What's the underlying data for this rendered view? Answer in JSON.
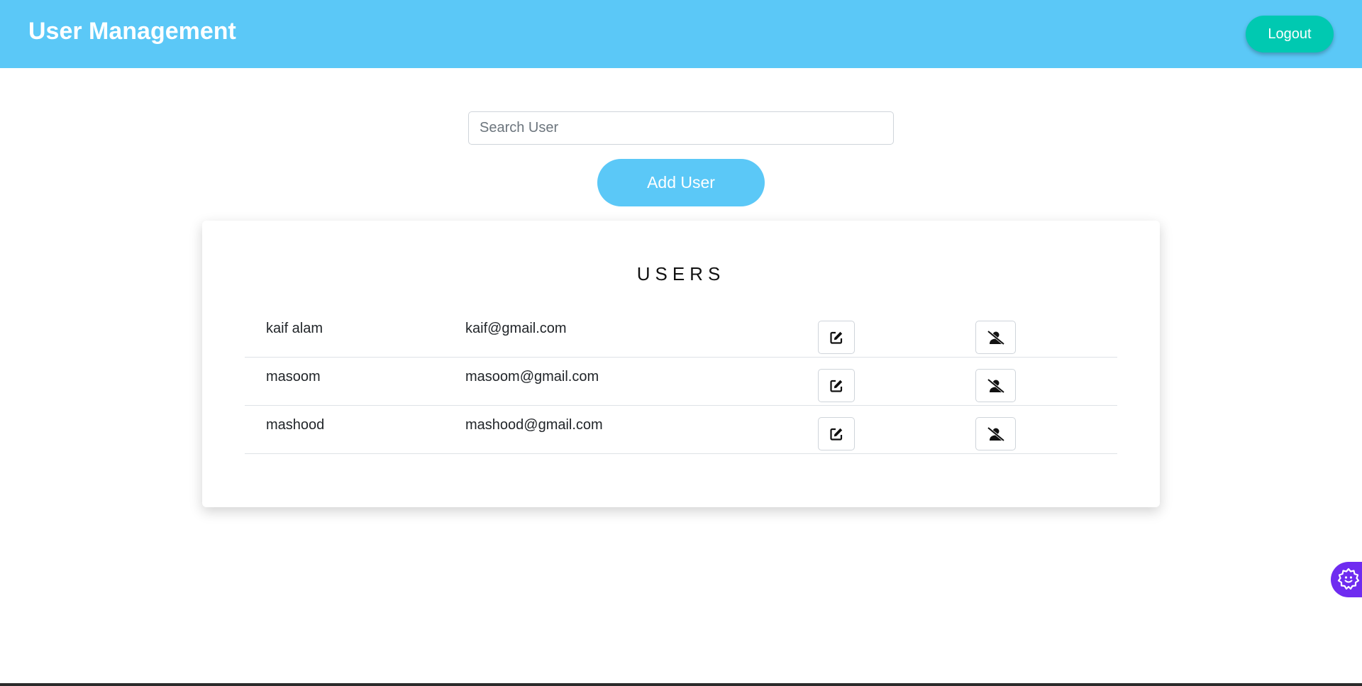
{
  "header": {
    "title": "User Management",
    "logout_label": "Logout"
  },
  "search": {
    "placeholder": "Search User",
    "value": ""
  },
  "add_user_label": "Add User",
  "users_card": {
    "title": "USERS",
    "rows": [
      {
        "name": "kaif alam",
        "email": "kaif@gmail.com"
      },
      {
        "name": "masoom",
        "email": "masoom@gmail.com"
      },
      {
        "name": "mashood",
        "email": "mashood@gmail.com"
      }
    ]
  },
  "icons": {
    "edit": "edit-icon",
    "block_user": "user-slash-icon",
    "floating": "gear-face-icon"
  },
  "colors": {
    "header_bg": "#5bc8f7",
    "logout_bg": "#00c9b1",
    "add_button_bg": "#5bc8f7",
    "floating_bg": "#6f2cf0"
  }
}
